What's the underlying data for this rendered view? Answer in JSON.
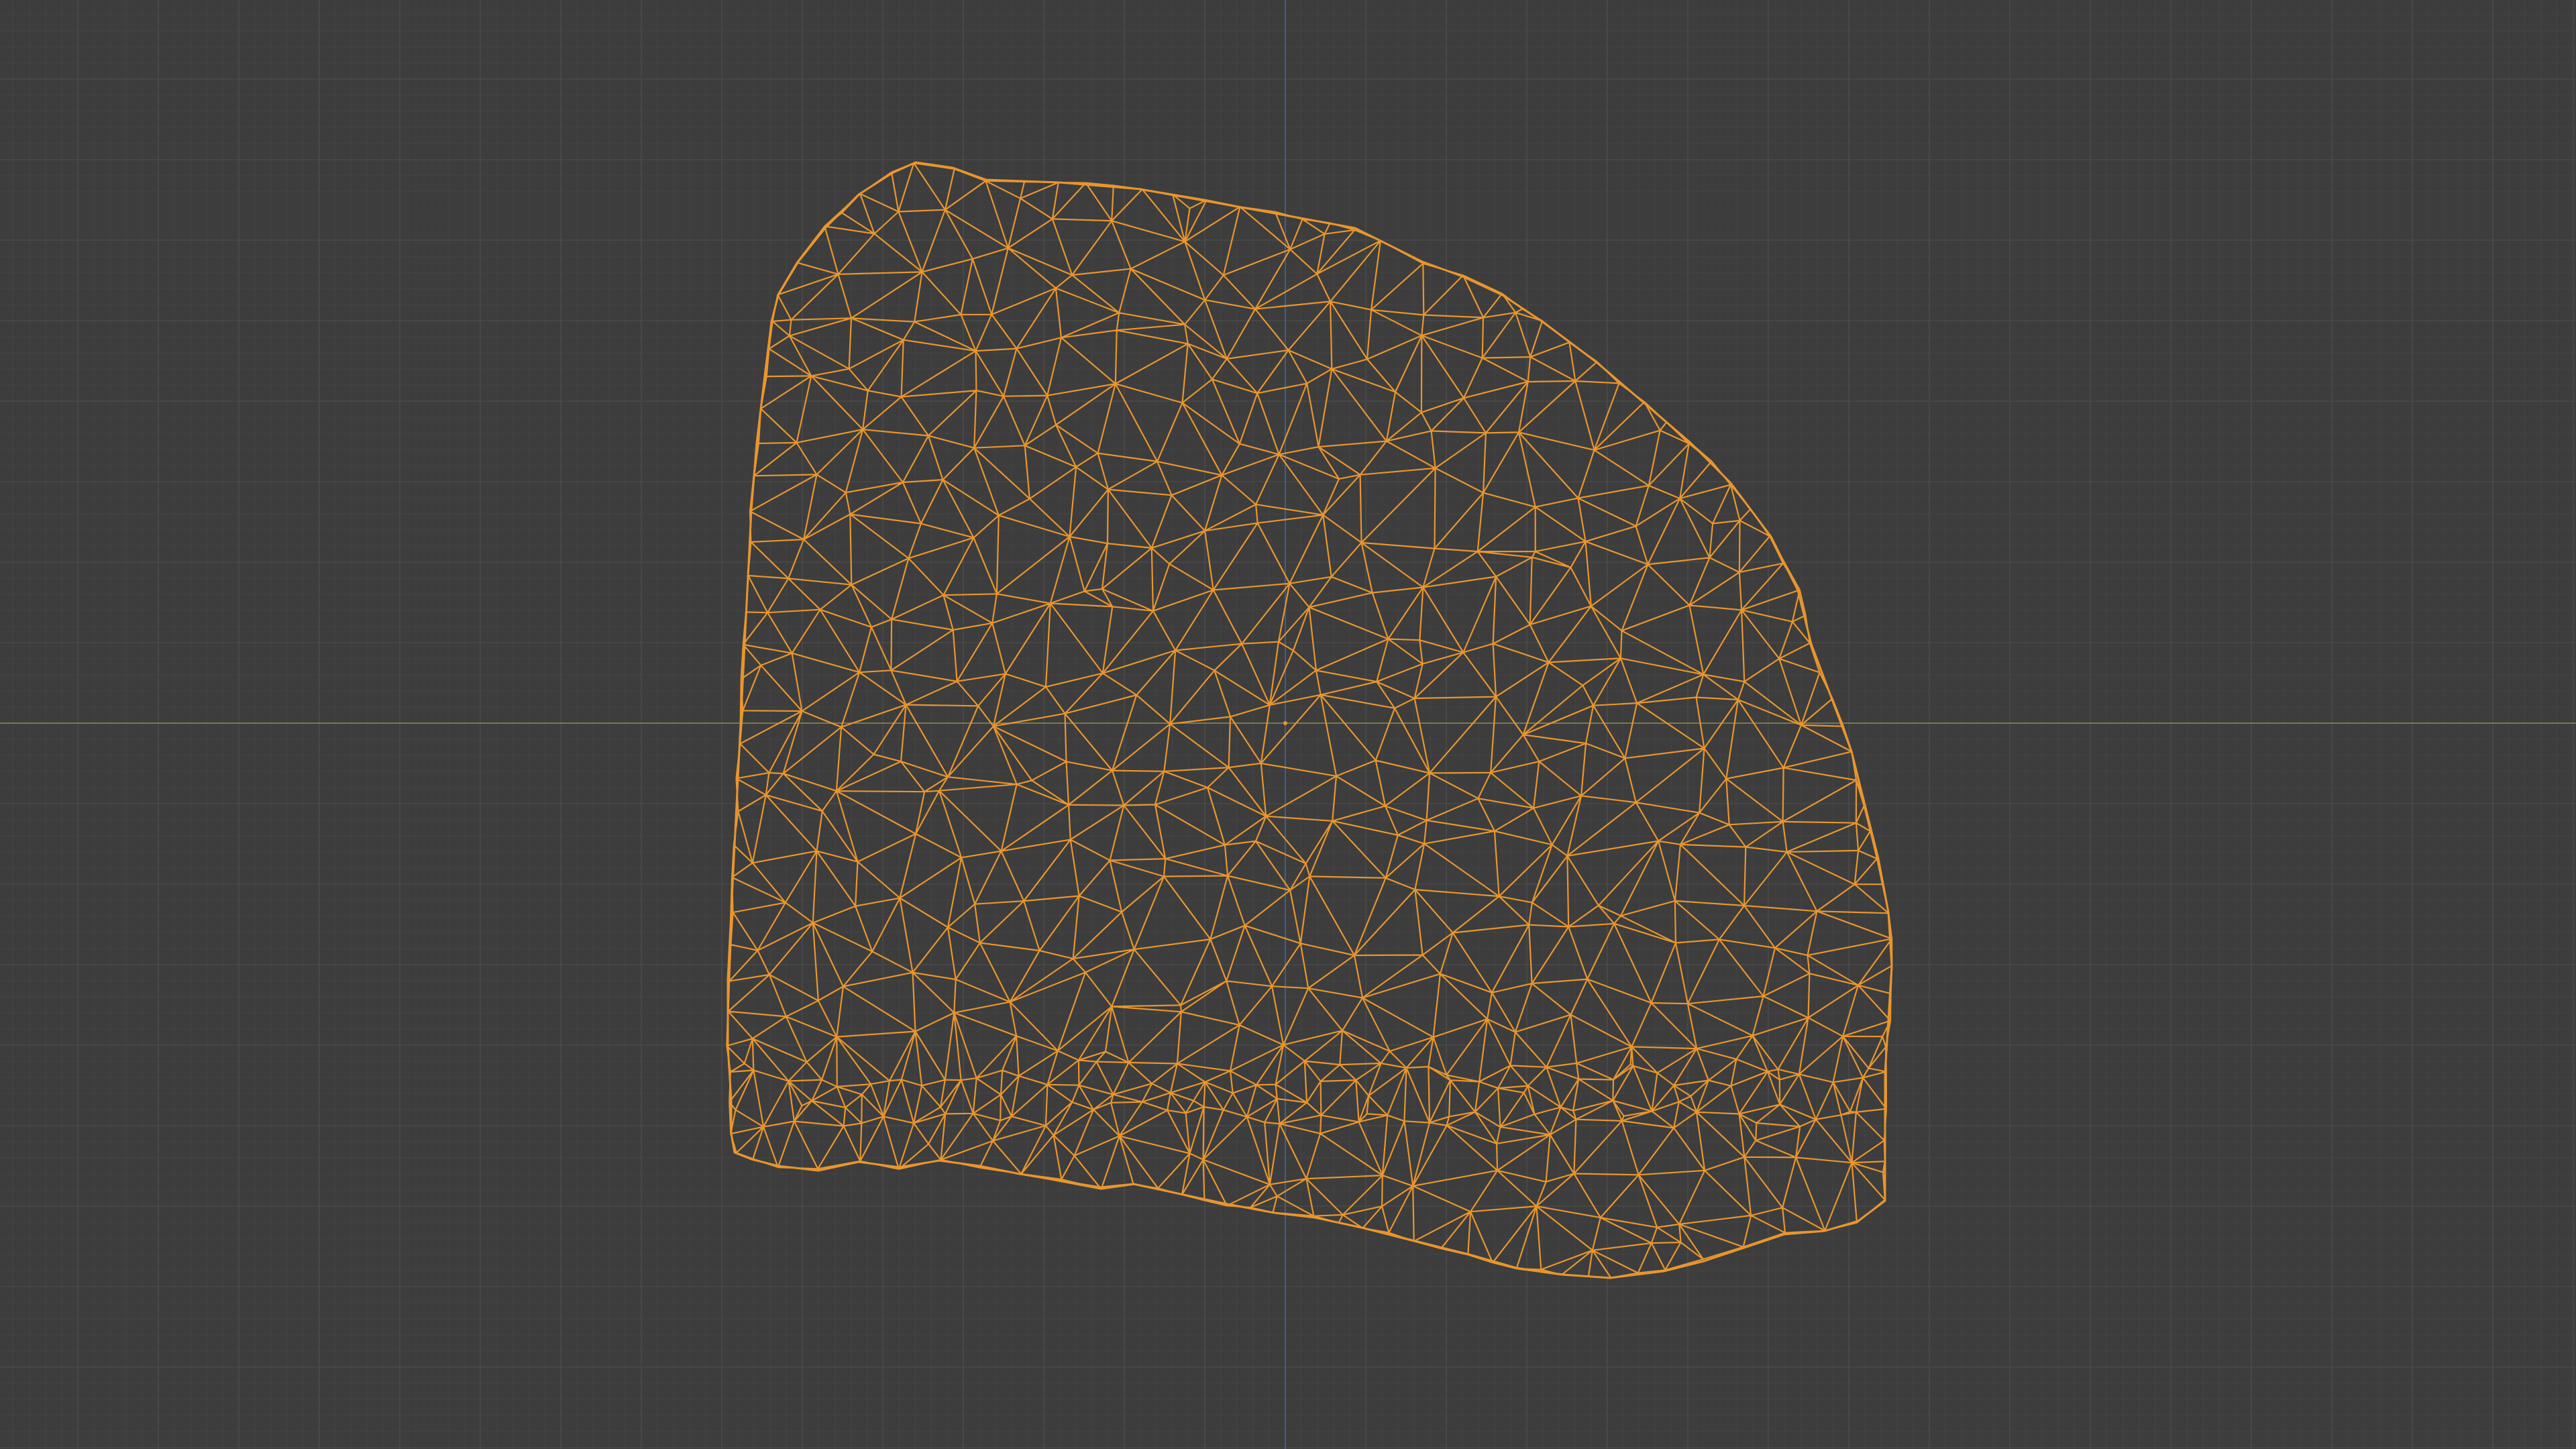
{
  "viewport": {
    "background_color": "#3d3d3d",
    "grid_minor_color": "#444444",
    "grid_major_color": "#4a4a4a",
    "x_axis_color": "#7a7a4a",
    "y_axis_color": "#3f5e8a",
    "wireframe_color": "#e8962f",
    "origin_marker_color": "#e8962f",
    "object_state": "selected"
  }
}
